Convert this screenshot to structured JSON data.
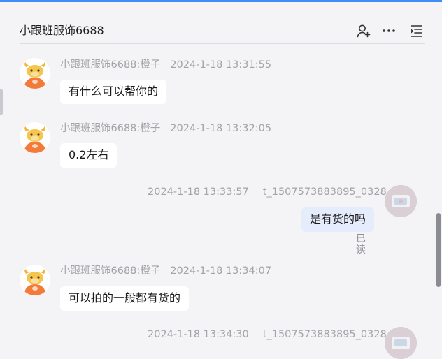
{
  "header": {
    "title": "小跟班服饰6688",
    "icons": [
      "add-contact-icon",
      "more-icon",
      "menu-list-icon"
    ]
  },
  "messages": [
    {
      "sender": "小跟班服饰6688:橙子",
      "time": "2024-1-18 13:31:55",
      "text": "有什么可以帮你的",
      "side": "left"
    },
    {
      "sender": "小跟班服饰6688:橙子",
      "time": "2024-1-18 13:32:05",
      "text": "0.2左右",
      "side": "left"
    },
    {
      "sender": "t_1507573883895_0328",
      "time": "2024-1-18 13:33:57",
      "text": "是有货的吗",
      "status": "已读",
      "side": "right"
    },
    {
      "sender": "小跟班服饰6688:橙子",
      "time": "2024-1-18 13:34:07",
      "text": "可以拍的一般都有货的",
      "side": "left"
    },
    {
      "sender": "t_1507573883895_0328",
      "time": "2024-1-18 13:34:30",
      "side": "right"
    }
  ],
  "colors": {
    "accent": "#3e8ef7",
    "background": "#f4f4f6",
    "self_bubble": "#e5ecfb",
    "avatar_orange": "#f47a3a"
  }
}
